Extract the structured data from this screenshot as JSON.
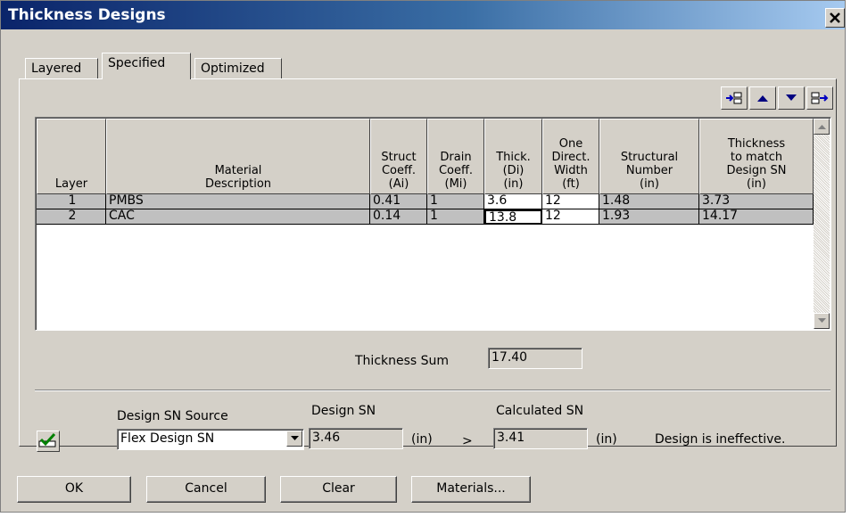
{
  "window": {
    "title": "Thickness Designs",
    "close_glyph": "✕"
  },
  "tabs": [
    {
      "label": "Layered",
      "active": false
    },
    {
      "label": "Specified",
      "active": true
    },
    {
      "label": "Optimized",
      "active": false
    }
  ],
  "toolbar": {
    "icons": [
      "insert-row-icon",
      "move-up-icon",
      "move-down-icon",
      "append-row-icon"
    ]
  },
  "grid": {
    "headers": [
      "Layer",
      "Material\nDescription",
      "Struct\nCoeff.\n(Ai)",
      "Drain\nCoeff.\n(Mi)",
      "Thick.\n(Di)\n(in)",
      "One\nDirect.\nWidth\n(ft)",
      "Structural\nNumber\n(in)",
      "Thickness\nto match\nDesign SN\n(in)"
    ],
    "rows": [
      {
        "layer": "1",
        "material": "PMBS",
        "struct": "0.41",
        "drain": "1",
        "thick": "3.6",
        "width": "12",
        "sn": "1.48",
        "match": "3.73"
      },
      {
        "layer": "2",
        "material": "CAC",
        "struct": "0.14",
        "drain": "1",
        "thick": "13.8",
        "width": "12",
        "sn": "1.93",
        "match": "14.17"
      }
    ]
  },
  "thickness_sum": {
    "label": "Thickness Sum",
    "value": "17.40"
  },
  "design": {
    "source_label": "Design SN Source",
    "source_value": "Flex Design SN",
    "design_sn_label": "Design SN",
    "design_sn_value": "3.46",
    "design_sn_unit": "(in)",
    "comparator": ">",
    "calc_sn_label": "Calculated SN",
    "calc_sn_value": "3.41",
    "calc_sn_unit": "(in)",
    "status": "Design is ineffective."
  },
  "buttons": {
    "ok": "OK",
    "cancel": "Cancel",
    "clear": "Clear",
    "materials": "Materials..."
  },
  "colors": {
    "face": "#d4d0c8",
    "title_start": "#0a246a",
    "title_end": "#a6caf0",
    "close_red": "#c0392b",
    "check_green": "#008000"
  }
}
